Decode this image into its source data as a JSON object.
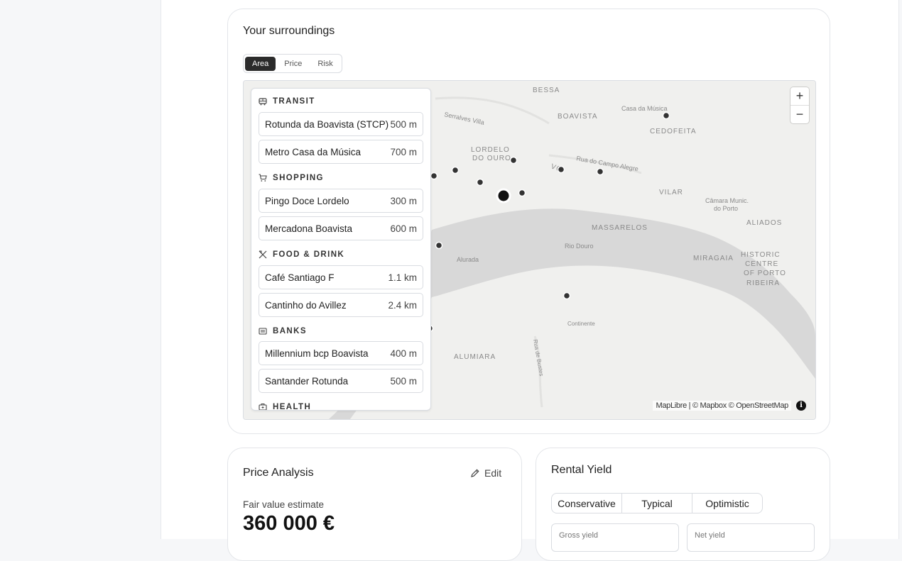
{
  "surroundings": {
    "title": "Your surroundings",
    "tabs": [
      "Area",
      "Price",
      "Risk"
    ],
    "active_tab": "Area",
    "map": {
      "labels": [
        "BESSA",
        "BOAVISTA",
        "Casa da Música",
        "CEDOFEITA",
        "LORDELO",
        "DO OURO",
        "Rua do Campo Alegre",
        "VILAR",
        "Câmara Munic.",
        "do Porto",
        "ALIADOS",
        "MASSARELOS",
        "Rio Douro",
        "MIRAGAIA",
        "HISTORIC",
        "CENTRE",
        "OF PORTO",
        "RIBEIRA",
        "Alurada",
        "Continente",
        "ALUMIARA",
        "Rua de Bustes",
        "Serralves Villa",
        "VCI"
      ],
      "zoom_in": "+",
      "zoom_out": "−",
      "attribution": {
        "maplibre": "MapLibre",
        "sep": " | ",
        "mapbox": "© Mapbox",
        "osm": "© OpenStreetMap"
      },
      "info": "i"
    },
    "categories": [
      {
        "name": "TRANSIT",
        "icon": "transit-icon",
        "items": [
          {
            "name": "Rotunda da Boavista (STCP)",
            "distance": "500 m"
          },
          {
            "name": "Metro Casa da Música",
            "distance": "700 m"
          }
        ]
      },
      {
        "name": "SHOPPING",
        "icon": "shopping-cart-icon",
        "items": [
          {
            "name": "Pingo Doce Lordelo",
            "distance": "300 m"
          },
          {
            "name": "Mercadona Boavista",
            "distance": "600 m"
          }
        ]
      },
      {
        "name": "FOOD & DRINK",
        "icon": "utensils-icon",
        "items": [
          {
            "name": "Café Santiago F",
            "distance": "1.1 km"
          },
          {
            "name": "Cantinho do Avillez",
            "distance": "2.4 km"
          }
        ]
      },
      {
        "name": "BANKS",
        "icon": "bank-icon",
        "items": [
          {
            "name": "Millennium bcp Boavista",
            "distance": "400 m"
          },
          {
            "name": "Santander Rotunda",
            "distance": "500 m"
          }
        ]
      },
      {
        "name": "HEALTH",
        "icon": "health-icon",
        "items": []
      }
    ]
  },
  "price_analysis": {
    "title": "Price Analysis",
    "edit_label": "Edit",
    "estimate_label": "Fair value estimate",
    "estimate_value": "360 000 €"
  },
  "rental_yield": {
    "title": "Rental Yield",
    "tabs": [
      "Conservative",
      "Typical",
      "Optimistic"
    ],
    "fields": {
      "gross_label": "Gross yield",
      "net_label": "Net yield"
    }
  }
}
